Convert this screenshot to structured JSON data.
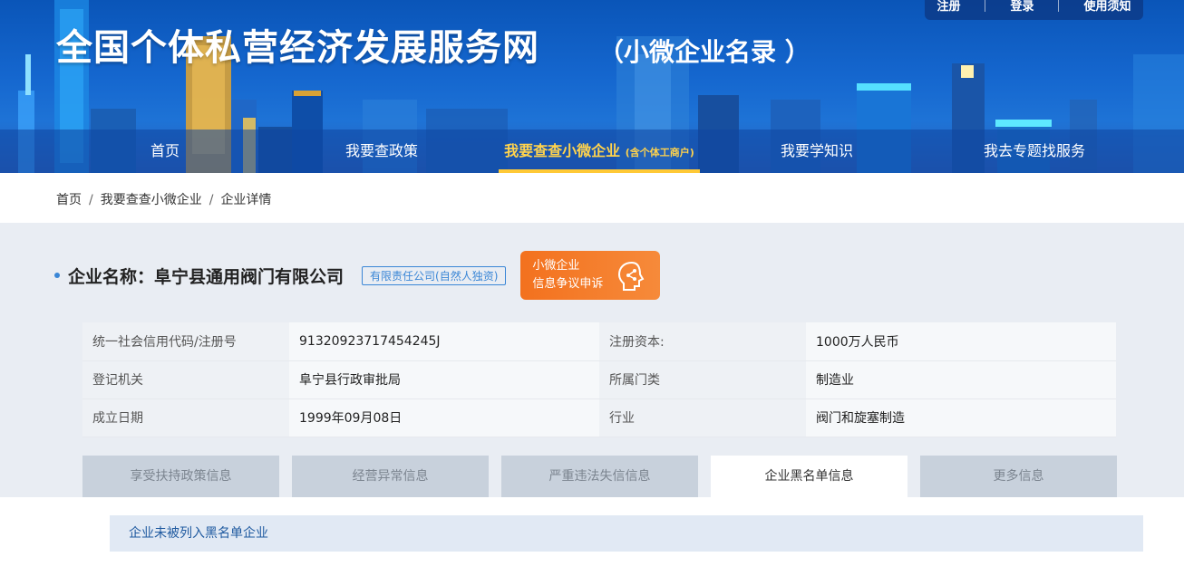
{
  "header": {
    "site_title": "全国个体私营经济发展服务网",
    "site_subtitle": "（小微企业名录 ）",
    "top_links": [
      "注册",
      "登录",
      "使用须知"
    ]
  },
  "nav": {
    "items": [
      {
        "label": "首页"
      },
      {
        "label": "我要查政策"
      },
      {
        "label": "我要查查小微企业",
        "suffix": "(含个体工商户)",
        "active": true
      },
      {
        "label": "我要学知识"
      },
      {
        "label": "我去专题找服务"
      }
    ]
  },
  "breadcrumb": [
    "首页",
    "我要查查小微企业",
    "企业详情"
  ],
  "company": {
    "label": "企业名称：",
    "name": "阜宁县通用阀门有限公司",
    "type": "有限责任公司(自然人独资)",
    "dispute_button": [
      "小微企业",
      "信息争议申诉"
    ]
  },
  "info": [
    {
      "k1": "统一社会信用代码/注册号",
      "v1": "91320923717454245J",
      "k2": "注册资本:",
      "v2": "1000万人民币"
    },
    {
      "k1": "登记机关",
      "v1": "阜宁县行政审批局",
      "k2": "所属门类",
      "v2": "制造业"
    },
    {
      "k1": "成立日期",
      "v1": "1999年09月08日",
      "k2": "行业",
      "v2": "阀门和旋塞制造"
    }
  ],
  "tabs": [
    {
      "label": "享受扶持政策信息",
      "active": false
    },
    {
      "label": "经营异常信息",
      "active": false
    },
    {
      "label": "严重违法失信信息",
      "active": false
    },
    {
      "label": "企业黑名单信息",
      "active": true
    },
    {
      "label": "更多信息",
      "active": false
    }
  ],
  "notice": "企业未被列入黑名单企业",
  "colors": {
    "brand_blue": "#1567cf",
    "accent_orange": "#f3711e",
    "nav_active": "#ffd34d"
  }
}
